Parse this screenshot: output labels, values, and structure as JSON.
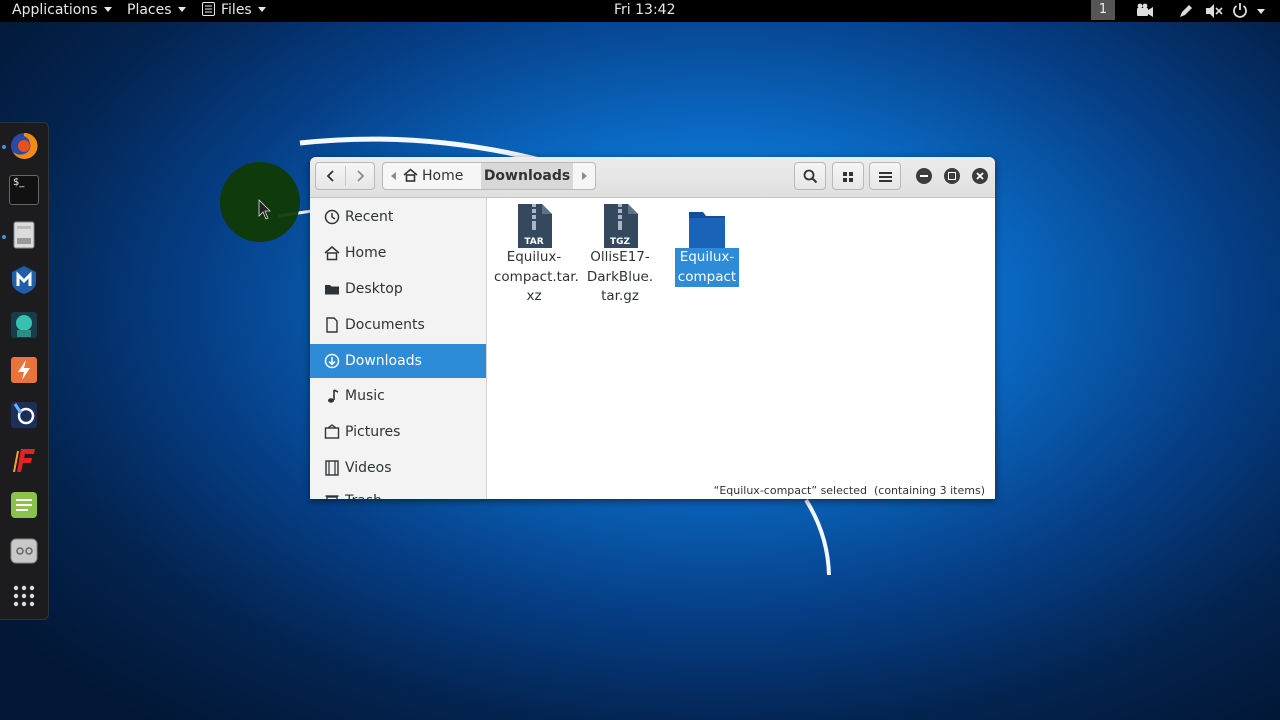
{
  "topbar": {
    "applications": "Applications",
    "places": "Places",
    "files": "Files",
    "clock": "Fri 13:42",
    "workspace": "1"
  },
  "dock": {
    "items": [
      "firefox-icon",
      "terminal-icon",
      "file-manager-icon",
      "metasploit-icon",
      "armitage-icon",
      "burpsuite-icon",
      "maltego-icon",
      "faraday-icon",
      "text-editor-icon",
      "settings-icon",
      "show-apps-icon"
    ]
  },
  "window": {
    "breadcrumb": {
      "home": "Home",
      "current": "Downloads"
    },
    "sidebar": {
      "items": [
        {
          "label": "Recent",
          "icon": "clock-icon"
        },
        {
          "label": "Home",
          "icon": "home-icon"
        },
        {
          "label": "Desktop",
          "icon": "folder-icon"
        },
        {
          "label": "Documents",
          "icon": "document-icon"
        },
        {
          "label": "Downloads",
          "icon": "download-icon",
          "active": true
        },
        {
          "label": "Music",
          "icon": "music-icon"
        },
        {
          "label": "Pictures",
          "icon": "pictures-icon"
        },
        {
          "label": "Videos",
          "icon": "video-icon"
        },
        {
          "label": "Trash",
          "icon": "trash-icon"
        }
      ]
    },
    "files": [
      {
        "lines": [
          "Equilux-",
          "compact.tar.",
          "xz"
        ],
        "badge": "TAR",
        "type": "archive"
      },
      {
        "lines": [
          "OllisE17-",
          "DarkBlue.",
          "tar.gz"
        ],
        "badge": "TGZ",
        "type": "archive"
      },
      {
        "lines": [
          "Equilux-",
          "compact"
        ],
        "type": "folder",
        "selected": true
      }
    ],
    "status": "“Equilux-compact” selected  (containing 3 items)"
  },
  "colors": {
    "accent": "#2d8bd8",
    "folder": "#1a63b8",
    "archive": "#34495e"
  }
}
